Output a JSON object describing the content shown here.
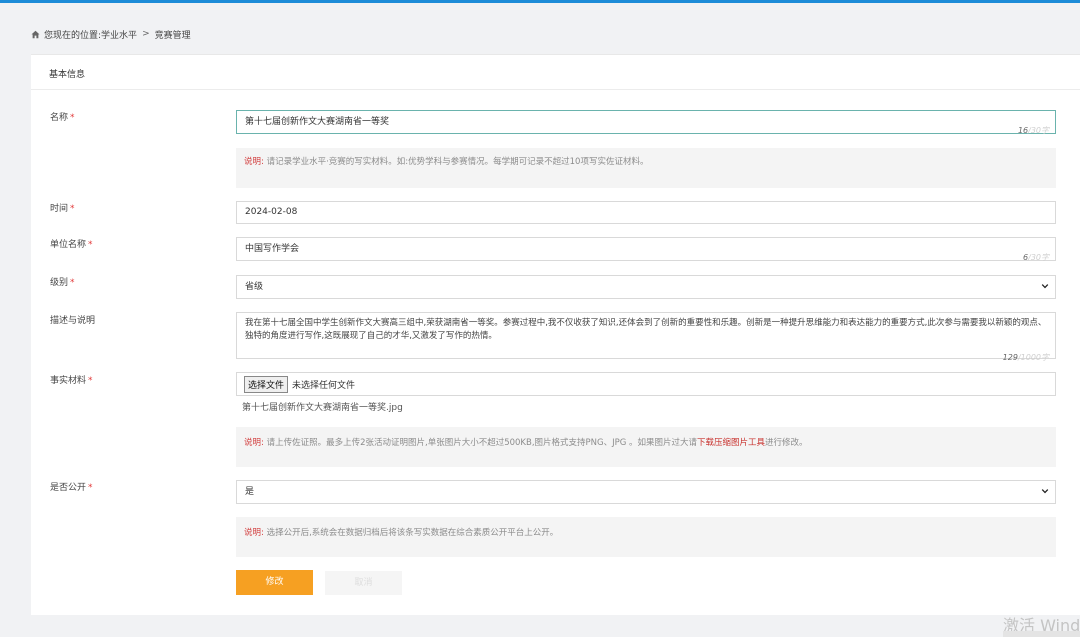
{
  "breadcrumb": {
    "prefix": "您现在的位置:",
    "level1": "学业水平",
    "separator": ">",
    "level2": "竞赛管理"
  },
  "section_title": "基本信息",
  "required_mark": "*",
  "form": {
    "name": {
      "label": "名称",
      "value": "第十七届创新作文大赛湖南省一等奖",
      "count": "16",
      "max": "/30字"
    },
    "name_hint": {
      "prefix": "说明:",
      "text": "请记录学业水平·竞赛的写实材料。如:优势学科与参赛情况。每学期可记录不超过10项写实佐证材料。"
    },
    "time": {
      "label": "时间",
      "value": "2024-02-08"
    },
    "org": {
      "label": "单位名称",
      "value": "中国写作学会",
      "count": "6",
      "max": "/30字"
    },
    "level": {
      "label": "级别",
      "value": "省级"
    },
    "desc": {
      "label": "描述与说明",
      "value": "我在第十七届全国中学生创新作文大赛高三组中,荣获湖南省一等奖。参赛过程中,我不仅收获了知识,还体会到了创新的重要性和乐趣。创新是一种提升思维能力和表达能力的重要方式,此次参与需要我以新颖的观点、独特的角度进行写作,这既展现了自己的才华,又激发了写作的热情。",
      "count": "129",
      "max": "/1000字"
    },
    "material": {
      "label": "事实材料",
      "button": "选择文件",
      "no_file": "未选择任何文件",
      "file_name": "第十七届创新作文大赛湖南省一等奖.jpg"
    },
    "material_hint": {
      "prefix": "说明:",
      "text": "请上传佐证照。最多上传2张活动证明图片,单张图片大小不超过500KB,图片格式支持PNG、JPG 。如果图片过大请",
      "link": "下载压缩图片工具",
      "suffix": "进行修改。"
    },
    "public": {
      "label": "是否公开",
      "value": "是"
    },
    "public_hint": {
      "prefix": "说明:",
      "text": "选择公开后,系统会在数据归档后将该条写实数据在综合素质公开平台上公开。"
    }
  },
  "buttons": {
    "submit": "修改",
    "cancel": "取消"
  },
  "watermark": "激活 Windows",
  "colors": {
    "accent": "#f6a022",
    "topbar": "#1d8cd8",
    "required": "#e23b3b"
  }
}
